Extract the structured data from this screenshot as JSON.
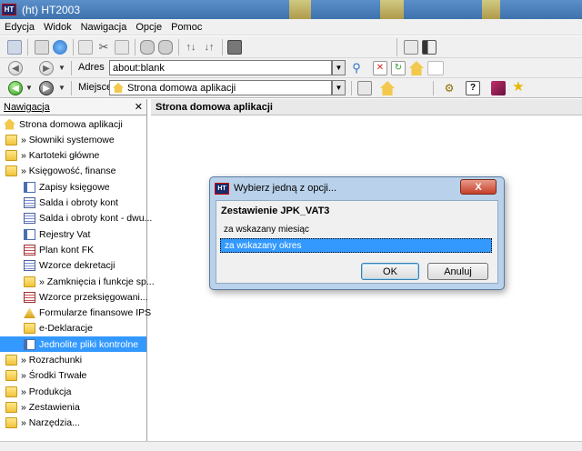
{
  "window": {
    "app_icon_text": "HT",
    "title": "(ht)  HT2003"
  },
  "menu": [
    "Edycja",
    "Widok",
    "Nawigacja",
    "Opcje",
    "Pomoc"
  ],
  "address_bar": {
    "label": "Adres",
    "value": "about:blank"
  },
  "location_bar": {
    "label": "Miejsce",
    "value": "Strona domowa aplikacji"
  },
  "navigation": {
    "title": "Nawigacja",
    "close": "✕",
    "items": [
      {
        "label": "Strona domowa aplikacji",
        "icon": "home-icon"
      },
      {
        "label": "» Słowniki systemowe",
        "icon": "folder-icon"
      },
      {
        "label": "» Kartoteki główne",
        "icon": "folder-icon"
      },
      {
        "label": "» Księgowość, finanse",
        "icon": "folder-icon"
      },
      {
        "label": "Zapisy księgowe",
        "icon": "document-icon"
      },
      {
        "label": "Salda i obroty kont",
        "icon": "grid-document-icon"
      },
      {
        "label": "Salda i obroty kont - dwu...",
        "icon": "grid-document-icon"
      },
      {
        "label": "Rejestry Vat",
        "icon": "document-icon"
      },
      {
        "label": "Plan kont FK",
        "icon": "red-document-icon"
      },
      {
        "label": "Wzorce dekretacji",
        "icon": "grid-document-icon"
      },
      {
        "label": "» Zamknięcia i funkcje sp...",
        "icon": "folder-icon"
      },
      {
        "label": "Wzorce przeksięgowani...",
        "icon": "red-document-icon"
      },
      {
        "label": "Formularze finansowe IPS",
        "icon": "pyramid-icon"
      },
      {
        "label": "e-Deklaracje",
        "icon": "folder-icon"
      },
      {
        "label": "Jednolite pliki kontrolne",
        "icon": "document-icon"
      },
      {
        "label": "» Rozrachunki",
        "icon": "folder-icon"
      },
      {
        "label": "» Środki Trwałe",
        "icon": "folder-icon"
      },
      {
        "label": "» Produkcja",
        "icon": "folder-icon"
      },
      {
        "label": "» Zestawienia",
        "icon": "folder-icon"
      },
      {
        "label": "» Narzędzia...",
        "icon": "folder-icon"
      }
    ],
    "selected_index": 14
  },
  "main": {
    "header": "Strona domowa aplikacji"
  },
  "dialog": {
    "icon_text": "HT",
    "title": "Wybierz jedną z opcji...",
    "close_label": "X",
    "heading": "Zestawienie JPK_VAT3",
    "options": [
      "za wskazany miesiąc",
      "za wskazany okres"
    ],
    "selected_option": 1,
    "ok_label": "OK",
    "cancel_label": "Anuluj"
  },
  "colors": {
    "selection": "#3399ff",
    "titlebar": "#4a7fbc",
    "dialog_frame": "#b9d1ea"
  }
}
